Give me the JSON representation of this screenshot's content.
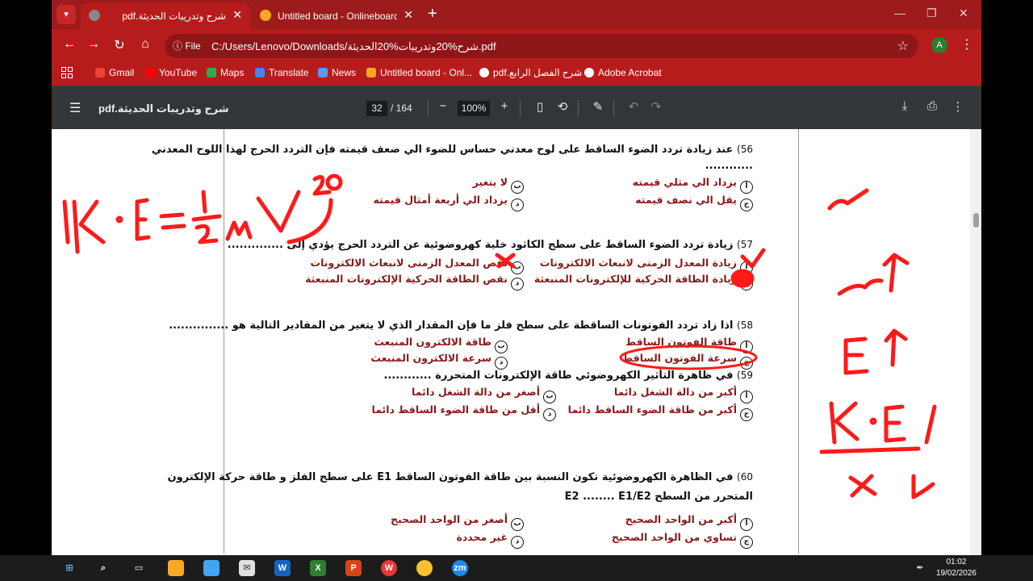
{
  "browser": {
    "tabs": [
      {
        "label": "pdf.شرح وتدريبات الحديثة",
        "active": true
      },
      {
        "label": "Untitled board - Onlineboard",
        "active": false
      }
    ],
    "file_chip": "File",
    "url": "C:/Users/Lenovo/Downloads/شرح%20وتدريبات%20الحديثة.pdf",
    "avatar_letter": "A",
    "bookmarks": [
      "Gmail",
      "YouTube",
      "Maps",
      "Translate",
      "News",
      "Untitled board - Onl...",
      "pdf.شرح الفصل الرابع",
      "Adobe Acrobat"
    ],
    "accent_color": "#b71c1c"
  },
  "pdf": {
    "title": "pdf.شرح وتدريبات الحديثة",
    "page_current": "32",
    "page_total": "/ 164",
    "zoom": "100%"
  },
  "questions": [
    {
      "num": "56)",
      "text": "عند زيادة تردد الضوء الساقط على لوح معدني حساس للضوء الي ضعف قيمته فإن التردد الحرج لهذا اللوح المعدني",
      "text2": "............",
      "options": [
        {
          "mark": "أ",
          "text": "يزداد الي مثلي قيمته"
        },
        {
          "mark": "ب",
          "text": "لا يتغير"
        },
        {
          "mark": "ج",
          "text": "يقل الي نصف قيمته"
        },
        {
          "mark": "د",
          "text": "يزداد الي أربعة أمثال قيمته"
        }
      ]
    },
    {
      "num": "57)",
      "text": "زيادة تردد الضوء الساقط على سطح الكاثود خلية كهروضوئية عن التردد الحرج يؤدي إلى ..............",
      "options": [
        {
          "mark": "أ",
          "text": "زيادة المعدل الزمنى لانبعاث الالكترونات"
        },
        {
          "mark": "ب",
          "text": "نقص المعدل الزمنى لانبعاث الالكترونات"
        },
        {
          "mark": "ج",
          "text": "زيادة الطاقة الحركية للإلكترونات المنبعثة"
        },
        {
          "mark": "د",
          "text": "نقص الطاقة الحركية الإلكترونات المنبعثة"
        }
      ]
    },
    {
      "num": "58)",
      "text": "اذا زاد تردد الفوتونات الساقطة على سطح فلز ما فإن المقدار الذي لا يتغير من المقادير التالية هو ...............",
      "options": [
        {
          "mark": "أ",
          "text": "طاقة الفوتون الساقط"
        },
        {
          "mark": "ب",
          "text": "طاقة الالكترون المنبعث"
        },
        {
          "mark": "ج",
          "text": "سرعة الفوتون الساقط"
        },
        {
          "mark": "د",
          "text": "سرعة الالكترون المنبعث"
        }
      ]
    },
    {
      "num": "59)",
      "text": "في ظاهرة التأثير الكهروضوئي طاقة الإلكترونات المتحررة ............",
      "options": [
        {
          "mark": "أ",
          "text": "أكبر من دالة الشغل دائما"
        },
        {
          "mark": "ب",
          "text": "أصغر من دالة الشغل دائما"
        },
        {
          "mark": "ج",
          "text": "أكبر من طاقة الضوء الساقط دائما"
        },
        {
          "mark": "د",
          "text": "أقل من طاقة الضوء الساقط دائما"
        }
      ]
    },
    {
      "num": "60)",
      "text": "في الظاهرة الكهروضوئية تكون النسبة بين طاقة الفوتون الساقط E1 على سطح الفلز و طاقة حركة الإلكترون",
      "text2": "المتحرر من السطح E2 ........ E1/E2",
      "options": [
        {
          "mark": "أ",
          "text": "أكبر من الواحد الصحيح"
        },
        {
          "mark": "ب",
          "text": "أصغر من الواحد الصحيح"
        },
        {
          "mark": "ج",
          "text": "تساوي من الواحد الصحيح"
        },
        {
          "mark": "د",
          "text": "غير محددة"
        }
      ]
    }
  ],
  "annotations": {
    "formula": "K.E = ½ m v²",
    "ink_color": "#ff1a1a"
  },
  "taskbar": {
    "time": "01:02",
    "date": "19/02/2026"
  }
}
